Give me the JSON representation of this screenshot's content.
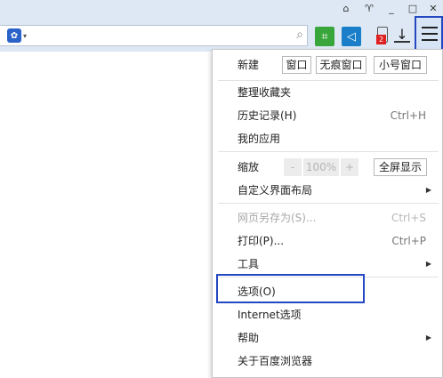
{
  "window_controls": {
    "home_glyph": "⌂",
    "skin_glyph": "♈",
    "minimize_glyph": "_",
    "restore_glyph": "□",
    "close_glyph": "✕"
  },
  "toolbar": {
    "engine_glyph": "✿",
    "engine_caret": "▾",
    "search_glyph": "⌕",
    "screenshot_glyph": "⌗",
    "sidebar_glyph": "◁",
    "phone_badge": "2",
    "download_glyph": "↓"
  },
  "menu": {
    "new_label": "新建",
    "new_window": "窗口",
    "new_incognito": "无痕窗口",
    "new_small": "小号窗口",
    "organize_favorites": "整理收藏夹",
    "history": "历史记录(H)",
    "history_shortcut": "Ctrl+H",
    "my_apps": "我的应用",
    "zoom_label": "缩放",
    "zoom_minus": "-",
    "zoom_value": "100%",
    "zoom_plus": "+",
    "fullscreen": "全屏显示",
    "customize_layout": "自定义界面布局",
    "save_page_as": "网页另存为(S)...",
    "save_shortcut": "Ctrl+S",
    "print": "打印(P)...",
    "print_shortcut": "Ctrl+P",
    "tools": "工具",
    "options": "选项(O)",
    "internet_options": "Internet选项",
    "help": "帮助",
    "about": "关于百度浏览器",
    "submenu_arrow": "▶"
  },
  "colors": {
    "toolbar_bg": "#dde8f4",
    "highlight_border": "#2448c2",
    "badge_red": "#e02020",
    "icon_green": "#39a63c",
    "icon_blue": "#1a7fc8"
  }
}
